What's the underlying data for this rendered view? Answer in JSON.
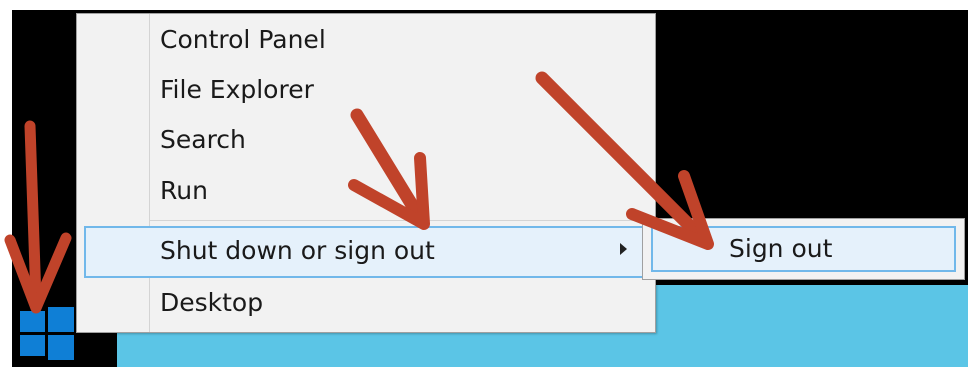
{
  "context_menu": {
    "items": [
      {
        "label": "Control Panel"
      },
      {
        "label": "File Explorer"
      },
      {
        "label": "Search"
      },
      {
        "label": "Run"
      },
      {
        "label": "Shut down or sign out",
        "has_submenu": true,
        "highlighted": true
      },
      {
        "label": "Desktop"
      }
    ]
  },
  "submenu": {
    "items": [
      {
        "label": "Sign out",
        "highlighted": true
      }
    ]
  },
  "icons": {
    "start": "windows-logo-icon",
    "submenu_indicator": "chevron-right-icon",
    "annotation": "red-arrow-icon"
  },
  "colors": {
    "menu_background": "#f2f2f2",
    "highlight_fill": "#e5f1fb",
    "highlight_border": "#71b8ea",
    "start_logo": "#0f7fd6",
    "taskbar_strip": "#5bc5e6",
    "annotation_arrow": "#c0432a",
    "screen_background": "#000000"
  }
}
